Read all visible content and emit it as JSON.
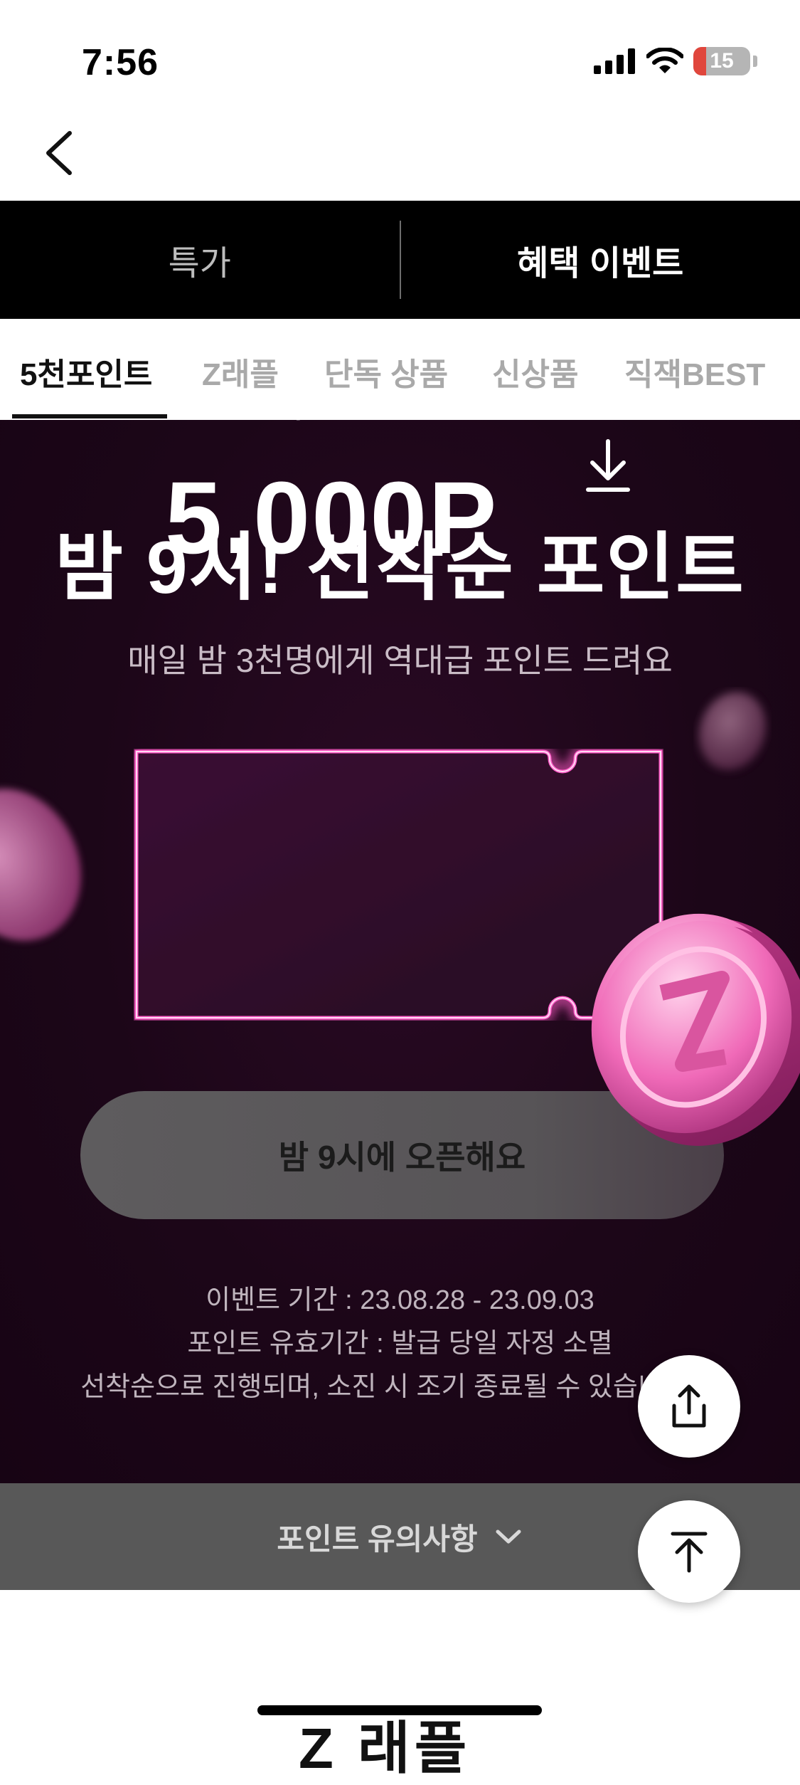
{
  "status_bar": {
    "time": "7:56",
    "battery_level": "15",
    "battery_color": "#e0463c"
  },
  "nav": {
    "back_icon": "chevron-left-icon"
  },
  "top_tabs": [
    {
      "label": "특가",
      "active": false
    },
    {
      "label": "혜택 이벤트",
      "active": true
    }
  ],
  "sub_tabs": [
    {
      "label": "5천포인트",
      "active": true
    },
    {
      "label": "Z래플",
      "active": false
    },
    {
      "label": "단독 상품",
      "active": false
    },
    {
      "label": "신상품",
      "active": false
    },
    {
      "label": "직잭BEST",
      "active": false
    }
  ],
  "hero": {
    "title": "밤 9시! 선착순 포인트",
    "subtitle": "매일 밤 3천명에게 역대급 포인트 드려요",
    "ticket": {
      "label": "밤 9시 선착순",
      "amount": "5,000P",
      "icon": "download-icon"
    },
    "open_button": "밤 9시에 오픈해요",
    "info_lines": [
      "이벤트 기간 : 23.08.28 - 23.09.03",
      "포인트 유효기간 : 발급 당일 자정 소멸",
      "선착순으로 진행되며, 소진 시 조기 종료될 수 있습니"
    ],
    "accent_color": "#ff3fb4"
  },
  "notice": {
    "label": "포인트 유의사항",
    "icon": "chevron-down-icon"
  },
  "fabs": {
    "share_icon": "share-icon",
    "top_icon": "scroll-to-top-icon"
  },
  "bottom": {
    "heading": "Z 래플"
  }
}
